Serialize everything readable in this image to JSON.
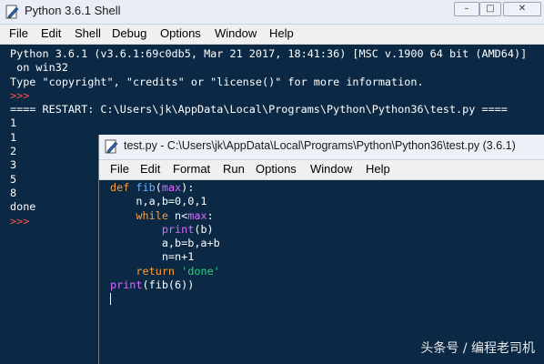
{
  "shell": {
    "title": "Python 3.6.1 Shell",
    "faint_title": "",
    "menu": [
      "File",
      "Edit",
      "Shell",
      "Debug",
      "Options",
      "Window",
      "Help"
    ],
    "lines": [
      "Python 3.6.1 (v3.6.1:69c0db5, Mar 21 2017, 18:41:36) [MSC v.1900 64 bit (AMD64)]",
      " on win32",
      "Type \"copyright\", \"credits\" or \"license()\" for more information.",
      "==== RESTART: C:\\Users\\jk\\AppData\\Local\\Programs\\Python\\Python36\\test.py ====",
      "1",
      "1",
      "2",
      "3",
      "5",
      "8",
      "done"
    ],
    "prompt": ">>>"
  },
  "editor": {
    "title": "test.py - C:\\Users\\jk\\AppData\\Local\\Programs\\Python\\Python36\\test.py (3.6.1)",
    "menu": [
      "File",
      "Edit",
      "Format",
      "Run",
      "Options",
      "Window",
      "Help"
    ],
    "code": {
      "l1_kw": "def",
      "l1_fn": "fib",
      "l1_arg": "max",
      "l2": "    n,a,b=0,0,1",
      "l3_kw": "while",
      "l3_rest": " n<",
      "l3_bi": "max",
      "l4_bi": "print",
      "l4_rest": "(b)",
      "l5": "        a,b=b,a+b",
      "l6": "        n=n+1",
      "l7_kw": "return",
      "l7_str": "'done'",
      "l8_bi": "print",
      "l8_rest": "(fib(6))"
    }
  },
  "watermark": "头条号 / 编程老司机",
  "colors": {
    "background": "#0b2945",
    "keyword": "#ff9d3b",
    "builtin": "#d86bff",
    "function_name": "#6ab0ff",
    "string": "#2fd17a",
    "prompt": "#ff5151"
  }
}
